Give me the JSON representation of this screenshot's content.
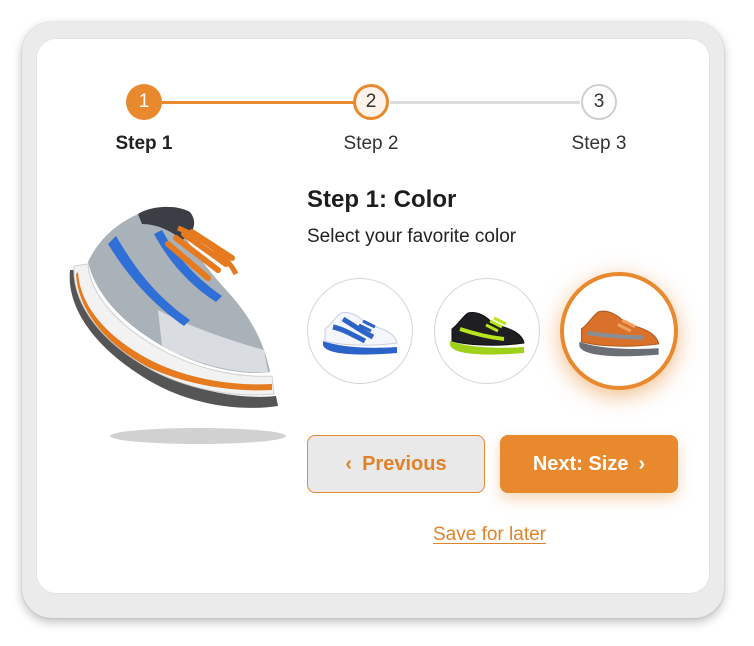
{
  "stepper": {
    "steps": [
      {
        "number": "1",
        "label": "Step 1",
        "state": "completed"
      },
      {
        "number": "2",
        "label": "Step 2",
        "state": "current"
      },
      {
        "number": "3",
        "label": "Step 3",
        "state": "upcoming"
      }
    ]
  },
  "main": {
    "heading": "Step 1: Color",
    "subheading": "Select your favorite color"
  },
  "color_options": [
    {
      "name": "blue-white",
      "selected": false
    },
    {
      "name": "black-lime",
      "selected": false
    },
    {
      "name": "orange-gray",
      "selected": true
    }
  ],
  "buttons": {
    "previous_label": "Previous",
    "next_label": "Next: Size",
    "previous_icon": "chevron-left-icon",
    "next_icon": "chevron-right-icon"
  },
  "save_link": "Save for later",
  "colors": {
    "accent": "#e8892e",
    "inactive": "#dcdcdc"
  }
}
